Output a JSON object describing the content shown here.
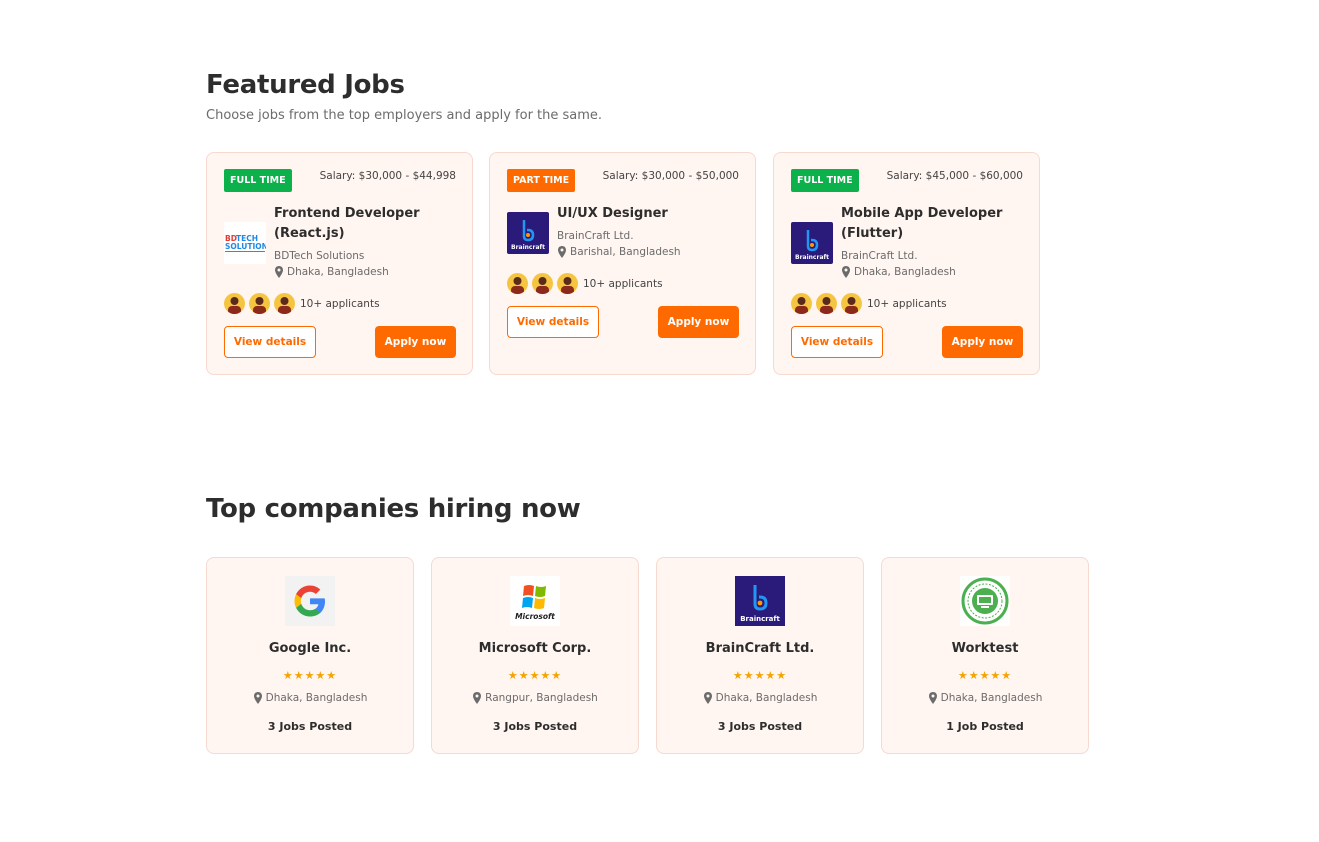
{
  "featured": {
    "title": "Featured Jobs",
    "subtitle": "Choose jobs from the top employers and apply for the same.",
    "jobs": [
      {
        "type": "FULL TIME",
        "type_color": "#0db14b",
        "salary": "Salary: $30,000 - $44,998",
        "title": "Frontend Developer (React.js)",
        "company": "BDTech Solutions",
        "location": "Dhaka, Bangladesh",
        "logo_text": "BDTECH SOLUTION",
        "applicants": "10+ applicants",
        "view_label": "View details",
        "apply_label": "Apply now"
      },
      {
        "type": "PART TIME",
        "type_color": "#ff6a00",
        "salary": "Salary: $30,000 - $50,000",
        "title": "UI/UX Designer",
        "company": "BrainCraft Ltd.",
        "location": "Barishal, Bangladesh",
        "logo_text": "Braincraft",
        "applicants": "10+ applicants",
        "view_label": "View details",
        "apply_label": "Apply now"
      },
      {
        "type": "FULL TIME",
        "type_color": "#0db14b",
        "salary": "Salary: $45,000 - $60,000",
        "title": "Mobile App Developer (Flutter)",
        "company": "BrainCraft Ltd.",
        "location": "Dhaka, Bangladesh",
        "logo_text": "Braincraft",
        "applicants": "10+ applicants",
        "view_label": "View details",
        "apply_label": "Apply now"
      }
    ]
  },
  "companies": {
    "title": "Top companies hiring now",
    "items": [
      {
        "name": "Google Inc.",
        "stars": "★★★★★",
        "rating": 5,
        "location": "Dhaka, Bangladesh",
        "jobs": "3 Jobs Posted",
        "logo": "google-logo"
      },
      {
        "name": "Microsoft Corp.",
        "stars": "★★★★★",
        "rating": 5,
        "location": "Rangpur, Bangladesh",
        "jobs": "3 Jobs Posted",
        "logo": "microsoft-logo",
        "logo_text": "Microsoft"
      },
      {
        "name": "BrainCraft Ltd.",
        "stars": "★★★★★",
        "rating": 5,
        "location": "Dhaka, Bangladesh",
        "jobs": "3 Jobs Posted",
        "logo": "braincraft-logo",
        "logo_text": "Braincraft"
      },
      {
        "name": "Worktest",
        "stars": "★★★★★",
        "rating": 5,
        "location": "Dhaka, Bangladesh",
        "jobs": "1 Job Posted",
        "logo": "worktest-logo"
      }
    ]
  },
  "colors": {
    "accent": "#ff6a00",
    "full_time": "#0db14b",
    "card_bg": "#fff5f1",
    "star": "#f5a300"
  }
}
